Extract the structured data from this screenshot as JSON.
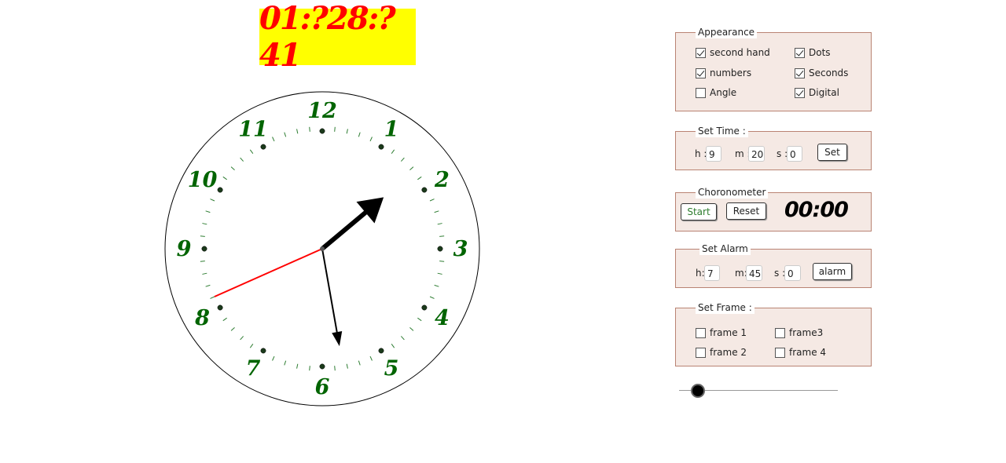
{
  "digital_time": "01:?28:?41",
  "clock": {
    "numbers": [
      "12",
      "1",
      "2",
      "3",
      "4",
      "5",
      "6",
      "7",
      "8",
      "9",
      "10",
      "11"
    ],
    "hour_hand_angle_deg": 50,
    "minute_hand_angle_deg": 170,
    "second_hand_angle_deg": 246,
    "number_color": "#006400",
    "second_hand_color": "#ff0000"
  },
  "appearance": {
    "title": "Appearance",
    "second_hand": {
      "label": "second hand",
      "checked": true
    },
    "dots": {
      "label": "Dots",
      "checked": true
    },
    "numbers": {
      "label": "numbers",
      "checked": true
    },
    "seconds": {
      "label": "Seconds",
      "checked": true
    },
    "angle": {
      "label": "Angle",
      "checked": false
    },
    "digital": {
      "label": "Digital",
      "checked": true
    }
  },
  "set_time": {
    "title": "Set Time :",
    "h_label": "h :",
    "h_value": "9",
    "m_label": "m :",
    "m_value": "20",
    "s_label": "s :",
    "s_value": "0",
    "button": "Set"
  },
  "chronometer": {
    "title": "Choronometer",
    "start": "Start",
    "reset": "Reset",
    "time": "00:00"
  },
  "set_alarm": {
    "title": "Set Alarm",
    "h_label": "h:",
    "h_value": "7",
    "m_label": "m:",
    "m_value": "45",
    "s_label": "s :",
    "s_value": "0",
    "button": "alarm"
  },
  "set_frame": {
    "title": "Set Frame :",
    "frame1": "frame 1",
    "frame3": "frame3",
    "frame2": "frame 2",
    "frame4": "frame 4"
  },
  "slider_value": 0.12
}
